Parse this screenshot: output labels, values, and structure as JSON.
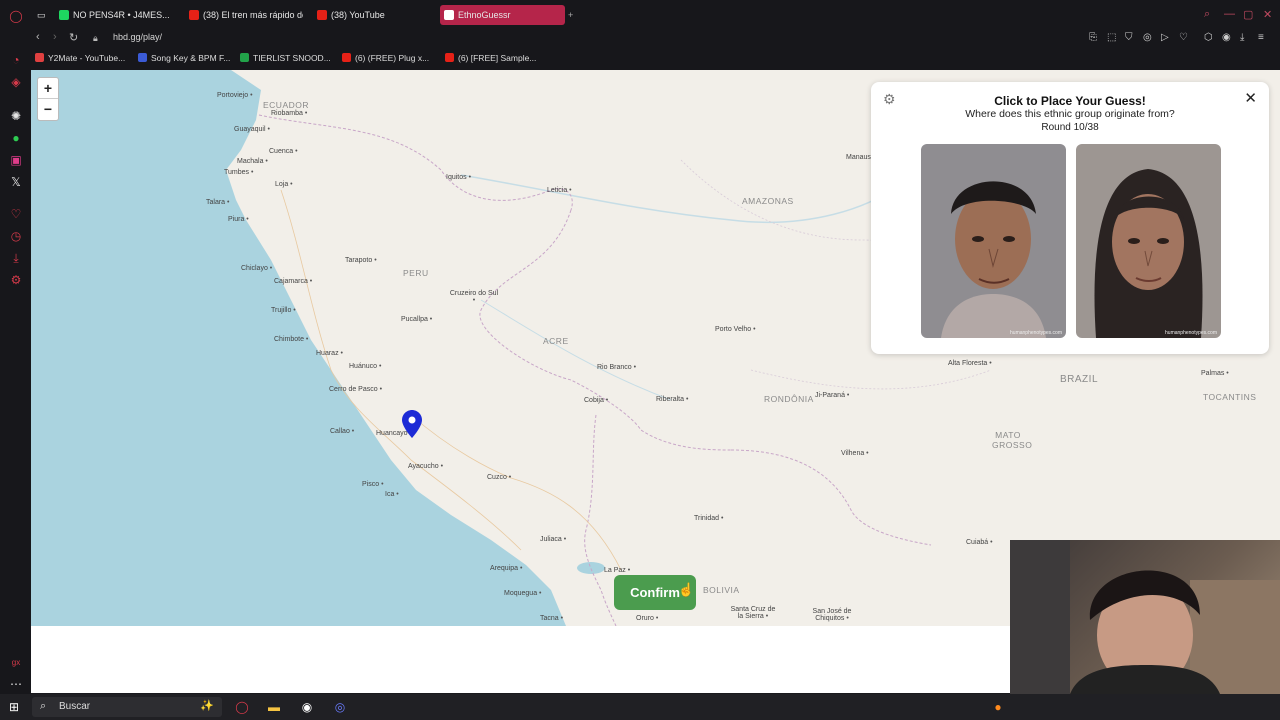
{
  "browser": {
    "tabs": [
      {
        "label": "NO PENS4R • J4MES...",
        "color": "#1ed760"
      },
      {
        "label": "(38) El tren más rápido de",
        "color": "#e62117"
      },
      {
        "label": "(38) YouTube",
        "color": "#e62117"
      },
      {
        "label": "EthnoGuessr",
        "color": "#ffffff",
        "active": true
      }
    ],
    "url": "hbd.gg/play/",
    "bookmarks": [
      {
        "label": "Y2Mate - YouTube...",
        "color": "#e04040"
      },
      {
        "label": "Song Key & BPM F...",
        "color": "#3b5bd6"
      },
      {
        "label": "TIERLIST SNOOD...",
        "color": "#22a34a"
      },
      {
        "label": "(6) (FREE) Plug x...",
        "color": "#e62117"
      },
      {
        "label": "(6) [FREE] Sample...",
        "color": "#e62117"
      }
    ]
  },
  "map": {
    "zoom_in": "+",
    "zoom_out": "−",
    "countries": [
      "ECUADOR",
      "PERU",
      "ACRE",
      "AMAZONAS",
      "RONDÔNIA",
      "BRAZIL",
      "MATO GROSSO",
      "TOCANTINS",
      "BOLIVIA"
    ],
    "places": [
      "Portoviejo",
      "Riobamba",
      "Guayaquil",
      "Cuenca",
      "Machala",
      "Tumbes",
      "Loja",
      "Talara",
      "Piura",
      "Chiclayo",
      "Cajamarca",
      "Trujillo",
      "Chimbote",
      "Huaraz",
      "Huánuco",
      "Cerro de Pasco",
      "Callao",
      "Huancayo",
      "Ayacucho",
      "Pisco",
      "Ica",
      "Cuzco",
      "Juliaca",
      "Arequipa",
      "Moquegua",
      "Tacna",
      "La Paz",
      "Oruro",
      "Iquitos",
      "Leticia",
      "Tarapoto",
      "Cruzeiro do Sul",
      "Pucallpa",
      "Rio Branco",
      "Cobija",
      "Riberalta",
      "Porto Velho",
      "Ji-Paraná",
      "Vilhena",
      "Trinidad",
      "Santa Cruz de la Sierra",
      "San José de Chiquitos",
      "Manaus",
      "Alta Floresta",
      "Cuiabá",
      "Palmas"
    ],
    "confirm_label": "Confirm"
  },
  "panel": {
    "title": "Click to Place Your Guess!",
    "subtitle": "Where does this ethnic group originate from?",
    "round": "Round 10/38",
    "close": "✕",
    "watermark": "humanphenotypes.com"
  },
  "taskbar": {
    "search_placeholder": "Buscar"
  }
}
